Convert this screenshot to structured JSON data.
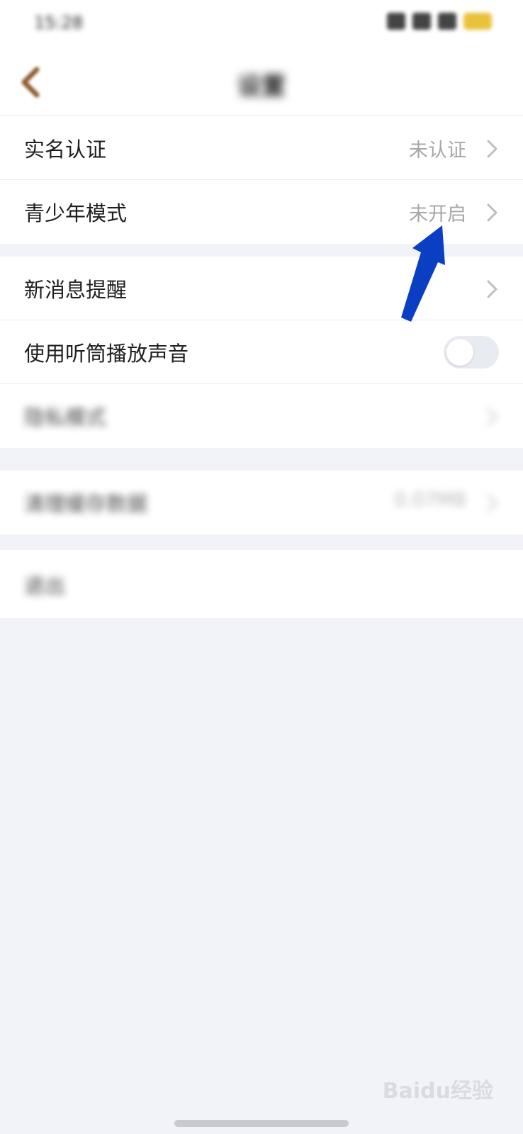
{
  "status_bar": {
    "time": "15:28"
  },
  "nav": {
    "title": "设置"
  },
  "groups": [
    {
      "rows": [
        {
          "label": "实名认证",
          "value": "未认证"
        },
        {
          "label": "青少年模式",
          "value": "未开启"
        }
      ]
    },
    {
      "rows": [
        {
          "label": "新消息提醒"
        },
        {
          "label": "使用听筒播放声音",
          "toggle_on": false
        },
        {
          "label": "隐私模式"
        }
      ]
    },
    {
      "rows": [
        {
          "label": "清理缓存数据",
          "value": "0.07MB"
        }
      ]
    },
    {
      "rows": [
        {
          "label": "退出"
        }
      ]
    }
  ],
  "watermark": "Baidu经验",
  "colors": {
    "accent_arrow": "#0a3fc4",
    "back_icon": "#8b5a2b"
  }
}
